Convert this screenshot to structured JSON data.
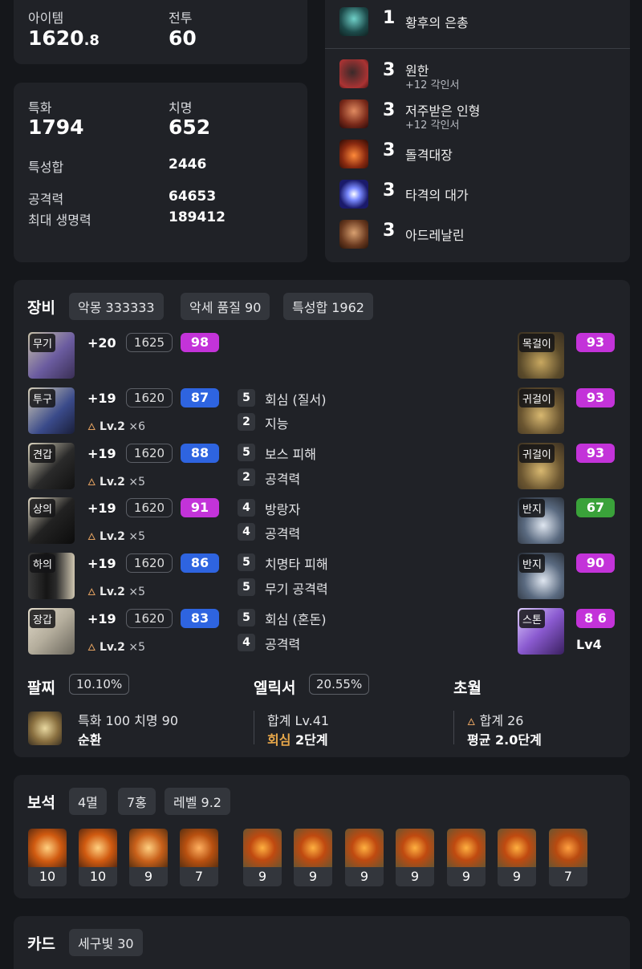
{
  "stats_top": {
    "item_label": "아이템",
    "item_value": "1620",
    "item_decimal": ".8",
    "combat_label": "전투",
    "combat_value": "60"
  },
  "stats": {
    "spec_label": "특화",
    "spec_value": "1794",
    "crit_label": "치명",
    "crit_value": "652",
    "total_label": "특성합",
    "total_value": "2446",
    "atk_label": "공격력",
    "atk_value": "64653",
    "hp_label": "최대 생명력",
    "hp_value": "189412"
  },
  "engravings": [
    {
      "level": "1",
      "name": "황후의 은총",
      "sub": ""
    },
    {
      "level": "3",
      "name": "원한",
      "sub": "+12 각인서"
    },
    {
      "level": "3",
      "name": "저주받은 인형",
      "sub": "+12 각인서"
    },
    {
      "level": "3",
      "name": "돌격대장",
      "sub": ""
    },
    {
      "level": "3",
      "name": "타격의 대가",
      "sub": ""
    },
    {
      "level": "3",
      "name": "아드레날린",
      "sub": ""
    }
  ],
  "equipment": {
    "title": "장비",
    "tags": [
      "악몽 333333",
      "악세 품질 90",
      "특성합 1962"
    ],
    "items": [
      {
        "slot": "무기",
        "plus": "+20",
        "ilvl": "1625",
        "quality": "98",
        "qcolor": "purple",
        "lv": "",
        "mult": "",
        "opts": []
      },
      {
        "slot": "투구",
        "plus": "+19",
        "ilvl": "1620",
        "quality": "87",
        "qcolor": "blue",
        "lv": "Lv.2",
        "mult": "×6",
        "opts": [
          {
            "n": "5",
            "t": "회심 (질서)"
          },
          {
            "n": "2",
            "t": "지능"
          }
        ]
      },
      {
        "slot": "견갑",
        "plus": "+19",
        "ilvl": "1620",
        "quality": "88",
        "qcolor": "blue",
        "lv": "Lv.2",
        "mult": "×5",
        "opts": [
          {
            "n": "5",
            "t": "보스 피해"
          },
          {
            "n": "2",
            "t": "공격력"
          }
        ]
      },
      {
        "slot": "상의",
        "plus": "+19",
        "ilvl": "1620",
        "quality": "91",
        "qcolor": "purple",
        "lv": "Lv.2",
        "mult": "×5",
        "opts": [
          {
            "n": "4",
            "t": "방랑자"
          },
          {
            "n": "4",
            "t": "공격력"
          }
        ]
      },
      {
        "slot": "하의",
        "plus": "+19",
        "ilvl": "1620",
        "quality": "86",
        "qcolor": "blue",
        "lv": "Lv.2",
        "mult": "×5",
        "opts": [
          {
            "n": "5",
            "t": "치명타 피해"
          },
          {
            "n": "5",
            "t": "무기 공격력"
          }
        ]
      },
      {
        "slot": "장갑",
        "plus": "+19",
        "ilvl": "1620",
        "quality": "83",
        "qcolor": "blue",
        "lv": "Lv.2",
        "mult": "×5",
        "opts": [
          {
            "n": "5",
            "t": "회심 (혼돈)"
          },
          {
            "n": "4",
            "t": "공격력"
          }
        ]
      }
    ],
    "accessories": [
      {
        "slot": "목걸이",
        "quality": "93",
        "qcolor": "purple"
      },
      {
        "slot": "귀걸이",
        "quality": "93",
        "qcolor": "purple"
      },
      {
        "slot": "귀걸이",
        "quality": "93",
        "qcolor": "purple"
      },
      {
        "slot": "반지",
        "quality": "67",
        "qcolor": "green"
      },
      {
        "slot": "반지",
        "quality": "90",
        "qcolor": "purple"
      },
      {
        "slot": "스톤",
        "quality": "8 6",
        "qcolor": "purple",
        "extra": "Lv4"
      }
    ]
  },
  "bracelet": {
    "title": "팔찌",
    "pct": "10.10%",
    "line1": "특화 100  치명 90",
    "line2": "순환"
  },
  "elixir": {
    "title": "엘릭서",
    "pct": "20.55%",
    "line1": "합계 Lv.41",
    "line2_a": "회심",
    "line2_b": "2단계"
  },
  "transcend": {
    "title": "초월",
    "line1": "합계 26",
    "line2": "평균 2.0단계"
  },
  "gems": {
    "title": "보석",
    "tags": [
      "4멸",
      "7홍",
      "레벨 9.2"
    ],
    "left": [
      "10",
      "10",
      "9",
      "7"
    ],
    "right": [
      "9",
      "9",
      "9",
      "9",
      "9",
      "9",
      "7"
    ]
  },
  "cards": {
    "title": "카드",
    "tag": "세구빛 30"
  }
}
